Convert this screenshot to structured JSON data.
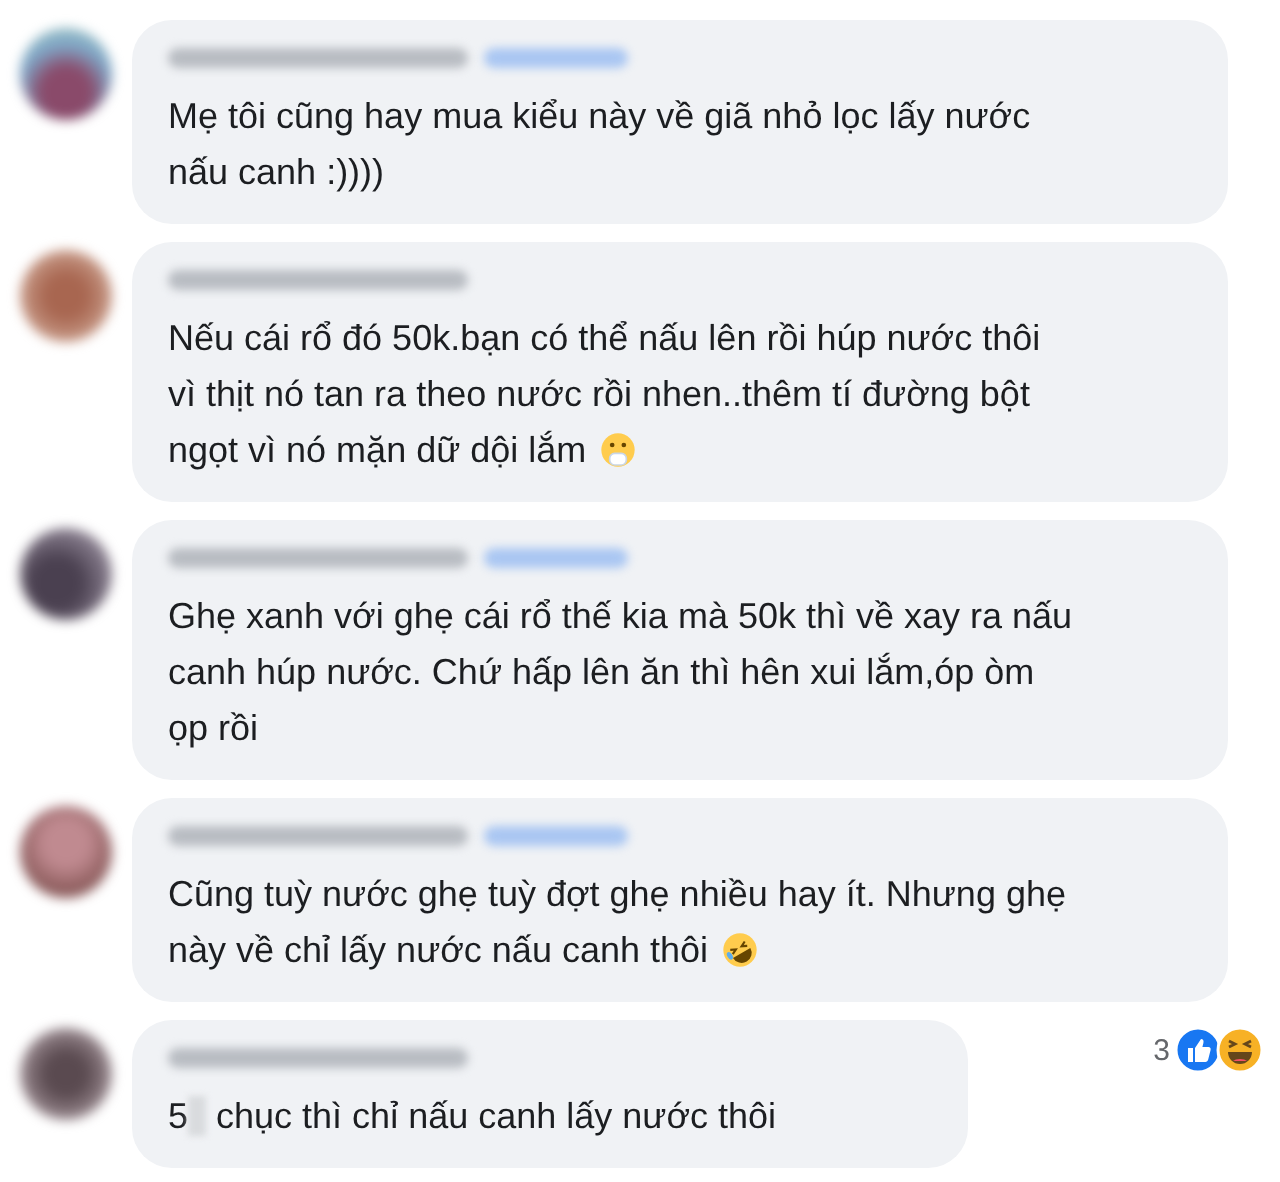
{
  "comments": [
    {
      "follow_link_blurred": true,
      "text": "Mẹ tôi cũng hay mua kiểu này về giã nhỏ lọc lấy nước\nnấu canh :))))"
    },
    {
      "follow_link_blurred": false,
      "text": "Nếu cái rổ đó 50k.bạn có thể nấu lên rồi húp nước thôi\nvì thịt nó tan ra theo nước rồi nhen..thêm tí đường bột\nngọt vì nó mặn dữ dội lắm",
      "emoji": {
        "kind": "hand-over-mouth"
      }
    },
    {
      "follow_link_blurred": true,
      "text": "Ghẹ xanh với ghẹ cái rổ thế kia mà 50k thì về xay ra nấu\ncanh húp nước. Chứ hấp lên ăn thì hên xui lắm,óp òm\nọp rồi"
    },
    {
      "follow_link_blurred": true,
      "text": "Cũng tuỳ nước ghẹ tuỳ đợt ghẹ nhiều hay ít. Nhưng ghẹ\nnày về chỉ lấy nước nấu canh thôi",
      "emoji": {
        "kind": "rolling-laugh"
      },
      "reactions": {
        "count": "3",
        "types": [
          {
            "kind": "like"
          },
          {
            "kind": "haha"
          }
        ]
      }
    },
    {
      "follow_link_blurred": false,
      "prefix": "5",
      "redacted": true,
      "text": "chục thì chỉ nấu canh lấy nước thôi"
    }
  ]
}
